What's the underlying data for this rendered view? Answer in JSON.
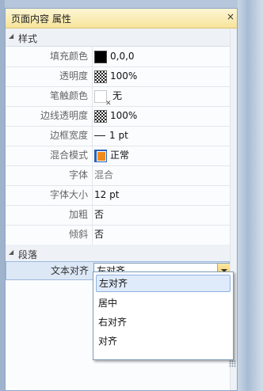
{
  "panel": {
    "title": "页面内容 属性"
  },
  "sections": {
    "style": "样式",
    "paragraph": "段落"
  },
  "properties": [
    {
      "label": "填充颜色",
      "value": "0,0,0",
      "icon": "black-swatch-icon"
    },
    {
      "label": "透明度",
      "value": "100%",
      "icon": "checker-icon"
    },
    {
      "label": "笔触颜色",
      "value": "无",
      "icon": "no-color-icon"
    },
    {
      "label": "边线透明度",
      "value": "100%",
      "icon": "checker-icon"
    },
    {
      "label": "边框宽度",
      "value": "1 pt",
      "icon": "line-icon"
    },
    {
      "label": "混合模式",
      "value": "正常",
      "icon": "blend-icon"
    },
    {
      "label": "字体",
      "value": "混合"
    },
    {
      "label": "字体大小",
      "value": "12 pt"
    },
    {
      "label": "加粗",
      "value": "否"
    },
    {
      "label": "倾斜",
      "value": "否"
    }
  ],
  "text_align": {
    "label": "文本对齐",
    "value": "左对齐",
    "options": [
      "左对齐",
      "居中",
      "右对齐",
      "对齐"
    ],
    "highlighted": "左对齐"
  },
  "colors": {
    "title_bar": "#f7e49a",
    "highlight": "#dfeafb",
    "blend_front": "#f08a1c",
    "blend_back": "#2b5fb4"
  }
}
